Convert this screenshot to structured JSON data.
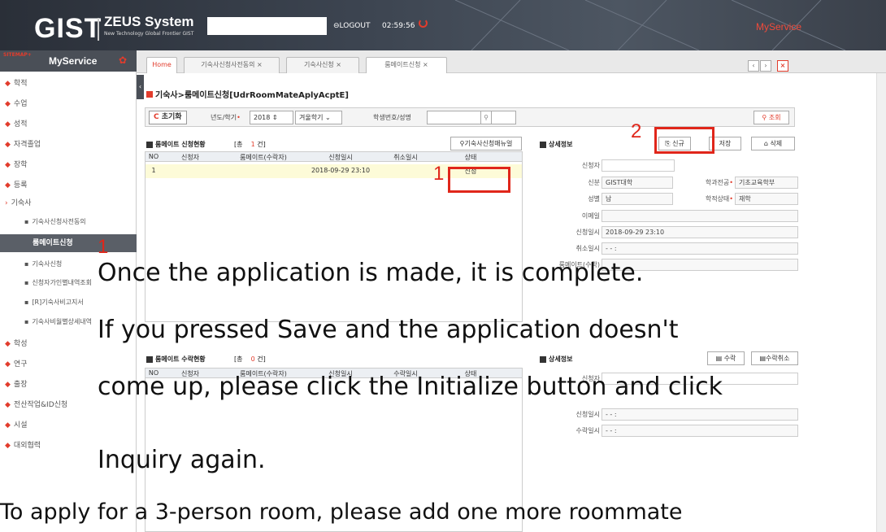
{
  "header": {
    "logo_text": "GIST",
    "system_title": "ZEUS System",
    "system_subtitle": "New Technology Global Frontier GIST",
    "logout_label": "LOGOUT",
    "session_timer": "02:59:56",
    "myservice_link": "MyService"
  },
  "sidebar": {
    "sitemap_label": "SITEMAP+",
    "title": "MyService",
    "items": [
      {
        "label": "학적"
      },
      {
        "label": "수업"
      },
      {
        "label": "성적"
      },
      {
        "label": "자격졸업"
      },
      {
        "label": "장학"
      },
      {
        "label": "등록"
      },
      {
        "label": "기숙사"
      },
      {
        "label": "기숙사신청사전동의"
      },
      {
        "label": "룸메이트신청"
      },
      {
        "label": "기숙사신청"
      },
      {
        "label": "신청자가인별내역조회"
      },
      {
        "label": "[R]기숙사비고지서"
      },
      {
        "label": "기숙사비월별상세내역"
      },
      {
        "label": "학성"
      },
      {
        "label": "연구"
      },
      {
        "label": "출장"
      },
      {
        "label": "전산작업&ID신청"
      },
      {
        "label": "시설"
      },
      {
        "label": "대외협력"
      }
    ]
  },
  "tabs": [
    {
      "label": "Home"
    },
    {
      "label": "기숙사신청사전동의 ×"
    },
    {
      "label": "기숙사신청 ×"
    },
    {
      "label": "룸메이트신청 ×"
    }
  ],
  "tab_nav": {
    "prev": "‹",
    "next": "›",
    "close": "×"
  },
  "page": {
    "breadcrumb": "기숙사>룸메이트신청[UdrRoomMateAplyAcptE]",
    "filter": {
      "reset_label": "초기화",
      "year_label": "년도/학기",
      "year_value": "2018",
      "term_value": "겨울학기",
      "student_label": "학생번호/성명",
      "search_label": "조회"
    },
    "status_section": {
      "title": "룸메이트 신청현황",
      "count_prefix": "[총",
      "count_value": "1",
      "count_suffix": "건]",
      "manual_button": "기숙사신청매뉴얼",
      "columns": [
        "NO",
        "신청자",
        "룸메이트(수락자)",
        "신청일시",
        "취소일시",
        "상태"
      ],
      "rows": [
        {
          "no": "1",
          "applicant": "",
          "roommate": "",
          "applied_at": "2018-09-29 23:10",
          "cancelled_at": "",
          "status": "신청"
        }
      ]
    },
    "detail_section": {
      "title": "상세정보",
      "new_button": "신규",
      "save_button": "저장",
      "delete_button": "삭제",
      "fields": {
        "applicant_label": "신청자",
        "identity_label": "신분",
        "identity_value": "GIST대학",
        "major_label": "학과전공",
        "major_value": "기초교육학부",
        "gender_label": "성별",
        "gender_value": "남",
        "status_label": "학적상태",
        "status_value": "재학",
        "email_label": "이메일",
        "applied_label": "신청일시",
        "applied_value": "2018-09-29 23:10",
        "cancel_label": "취소일시",
        "cancel_value": "- -  :",
        "roommate_label": "룸메이트(수락)"
      }
    },
    "accept_section": {
      "title": "룸메이트 수락현황",
      "count_prefix": "[총",
      "count_value": "0",
      "count_suffix": "건]",
      "columns": [
        "NO",
        "신청자",
        "룸메이트(수락자)",
        "신청일시",
        "수락일시",
        "상태"
      ]
    },
    "accept_detail": {
      "title": "상세정보",
      "accept_button": "수락",
      "accept_cancel_button": "수락취소",
      "applicant_label": "신청자",
      "applied_label": "신청일시",
      "applied_value": "- -  :",
      "accepted_label": "수락일시",
      "accepted_value": "- -  :"
    }
  },
  "annotations": {
    "marker_1a": "1",
    "marker_1b": "1",
    "marker_2": "2",
    "line1": "Once the application is made, it is complete.",
    "line2": "If  you  pressed  Save  and  the  application  doesn't",
    "line3": "come up, please click the Initialize button and click",
    "line4": "Inquiry again.",
    "line5": "To apply for a 3-person room, please add one more roommate"
  },
  "colors": {
    "accent": "#e23c2c",
    "annotation_red": "#e0261a"
  }
}
